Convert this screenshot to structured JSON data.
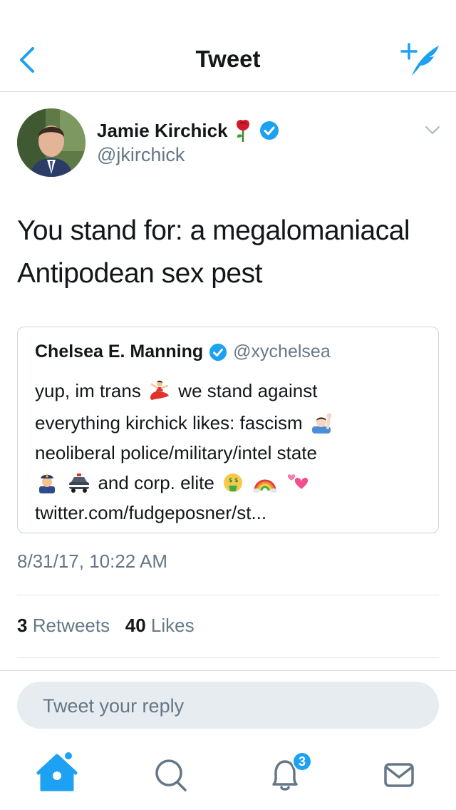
{
  "nav": {
    "title": "Tweet"
  },
  "tweet": {
    "author_name": "Jamie Kirchick",
    "author_handle": "@jkirchick",
    "text_line1": "You stand for: a megalomaniacal",
    "text_line2": "Antipodean sex pest",
    "timestamp": "8/31/17, 10:22 AM",
    "retweet_count": "3",
    "retweet_label": "Retweets",
    "like_count": "40",
    "like_label": "Likes"
  },
  "quoted_tweet": {
    "author_name": "Chelsea E. Manning",
    "author_handle": "@xychelsea",
    "line1_a": "yup, im trans",
    "line1_b": "we stand against",
    "line2": "everything kirchick likes: fascism",
    "line3": "neoliberal police/military/intel state",
    "line4": "and corp. elite",
    "line5": "twitter.com/fudgeposner/st..."
  },
  "reply": {
    "placeholder": "Tweet your reply"
  },
  "tabbar": {
    "notifications_badge": "3"
  },
  "icons": {
    "back": "chevron-left-icon",
    "compose": "compose-tweet-icon",
    "home": "home-icon",
    "search": "search-icon",
    "notifications": "bell-icon",
    "messages": "envelope-icon"
  },
  "colors": {
    "accent": "#1da1f2",
    "secondary_text": "#657786",
    "primary_text": "#14171a"
  }
}
